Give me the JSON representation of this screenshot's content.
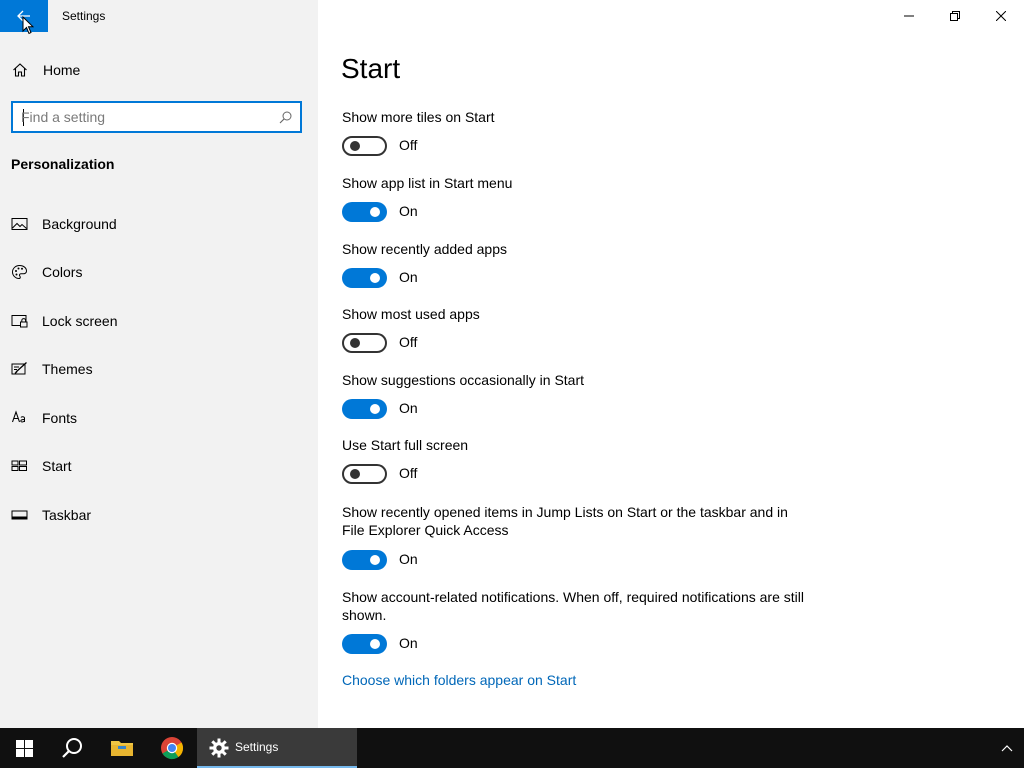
{
  "window": {
    "title": "Settings"
  },
  "sidebar": {
    "home_label": "Home",
    "search_placeholder": "Find a setting",
    "section_heading": "Personalization",
    "items": [
      {
        "label": "Background",
        "icon": "picture-icon"
      },
      {
        "label": "Colors",
        "icon": "palette-icon"
      },
      {
        "label": "Lock screen",
        "icon": "lock-screen-icon"
      },
      {
        "label": "Themes",
        "icon": "themes-icon"
      },
      {
        "label": "Fonts",
        "icon": "fonts-icon"
      },
      {
        "label": "Start",
        "icon": "start-icon"
      },
      {
        "label": "Taskbar",
        "icon": "taskbar-icon"
      }
    ]
  },
  "main": {
    "title": "Start",
    "settings": [
      {
        "label": "Show more tiles on Start",
        "state": "Off",
        "on": false
      },
      {
        "label": "Show app list in Start menu",
        "state": "On",
        "on": true
      },
      {
        "label": "Show recently added apps",
        "state": "On",
        "on": true
      },
      {
        "label": "Show most used apps",
        "state": "Off",
        "on": false
      },
      {
        "label": "Show suggestions occasionally in Start",
        "state": "On",
        "on": true
      },
      {
        "label": "Use Start full screen",
        "state": "Off",
        "on": false
      },
      {
        "label": "Show recently opened items in Jump Lists on Start or the taskbar and in File Explorer Quick Access",
        "state": "On",
        "on": true
      },
      {
        "label": "Show account-related notifications. When off, required notifications are still shown.",
        "state": "On",
        "on": true
      }
    ],
    "folders_link": "Choose which folders appear on Start"
  },
  "taskbar": {
    "settings_label": "Settings"
  },
  "colors": {
    "accent": "#0078d7",
    "link": "#0067b8",
    "sidebar_bg": "#f2f2f2",
    "taskbar_bg": "#101010"
  }
}
